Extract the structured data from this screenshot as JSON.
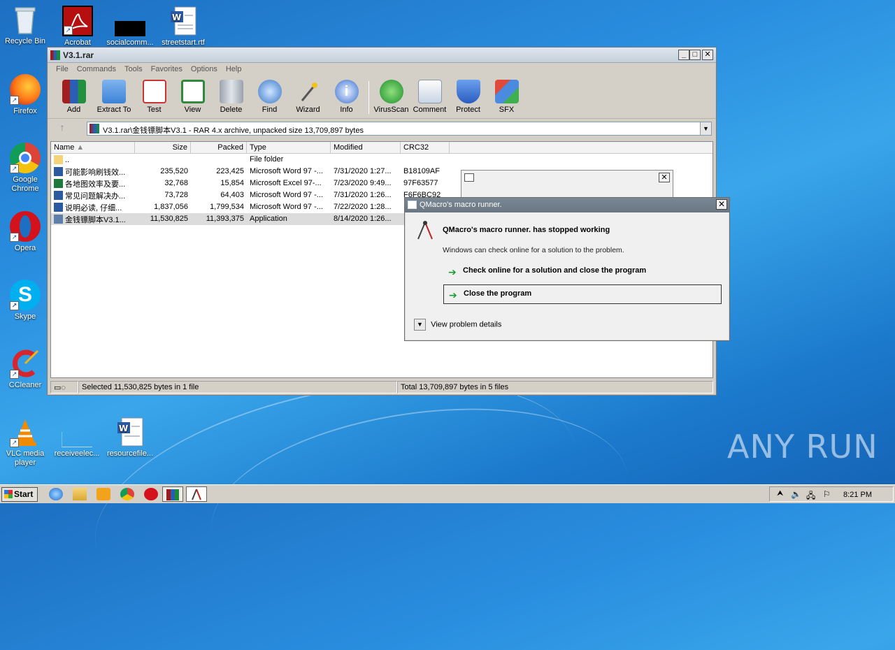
{
  "desktop": {
    "icons": [
      {
        "label": "Recycle Bin"
      },
      {
        "label": "Acrobat"
      },
      {
        "label": "socialcomm..."
      },
      {
        "label": "streetstart.rtf"
      },
      {
        "label": "Firefox"
      },
      {
        "label": "Google Chrome"
      },
      {
        "label": "Opera"
      },
      {
        "label": "Skype"
      },
      {
        "label": "CCleaner"
      },
      {
        "label": "VLC media player"
      },
      {
        "label": "receiveelec..."
      },
      {
        "label": "resourcefile..."
      }
    ],
    "watermark": "ANY RUN"
  },
  "winrar": {
    "title": "V3.1.rar",
    "menu": [
      "File",
      "Commands",
      "Tools",
      "Favorites",
      "Options",
      "Help"
    ],
    "toolbar": [
      "Add",
      "Extract To",
      "Test",
      "View",
      "Delete",
      "Find",
      "Wizard",
      "Info",
      "VirusScan",
      "Comment",
      "Protect",
      "SFX"
    ],
    "address": "V3.1.rar\\金钱镖脚本V3.1 - RAR 4.x archive, unpacked size 13,709,897 bytes",
    "columns": [
      "Name",
      "Size",
      "Packed",
      "Type",
      "Modified",
      "CRC32"
    ],
    "files": [
      {
        "name": "..",
        "size": "",
        "packed": "",
        "type": "File folder",
        "modified": "",
        "crc": "",
        "icon": "folder"
      },
      {
        "name": "可能影响刷钱效...",
        "size": "235,520",
        "packed": "223,425",
        "type": "Microsoft Word 97 -...",
        "modified": "7/31/2020 1:27...",
        "crc": "B18109AF",
        "icon": "word"
      },
      {
        "name": "各地图效率及要...",
        "size": "32,768",
        "packed": "15,854",
        "type": "Microsoft Excel 97-...",
        "modified": "7/23/2020 9:49...",
        "crc": "97F63577",
        "icon": "excel"
      },
      {
        "name": "常见问题解决办...",
        "size": "73,728",
        "packed": "64,403",
        "type": "Microsoft Word 97 -...",
        "modified": "7/31/2020 1:26...",
        "crc": "F6F6BC92",
        "icon": "word"
      },
      {
        "name": "说明必读, 仔细...",
        "size": "1,837,056",
        "packed": "1,799,534",
        "type": "Microsoft Word 97 -...",
        "modified": "7/22/2020 1:28...",
        "crc": "",
        "icon": "word"
      },
      {
        "name": "金钱镖脚本V3.1...",
        "size": "11,530,825",
        "packed": "11,393,375",
        "type": "Application",
        "modified": "8/14/2020 1:26...",
        "crc": "",
        "icon": "app",
        "selected": true
      }
    ],
    "status_left": "Selected 11,530,825 bytes in 1 file",
    "status_right": "Total 13,709,897 bytes in 5 files"
  },
  "crash_dialog": {
    "title": "QMacro's macro runner.",
    "heading": "QMacro's macro runner. has stopped working",
    "subtext": "Windows can check online for a solution to the problem.",
    "option_check": "Check online for a solution and close the program",
    "option_close": "Close the program",
    "details": "View problem details"
  },
  "taskbar": {
    "start": "Start",
    "clock": "8:21 PM"
  }
}
